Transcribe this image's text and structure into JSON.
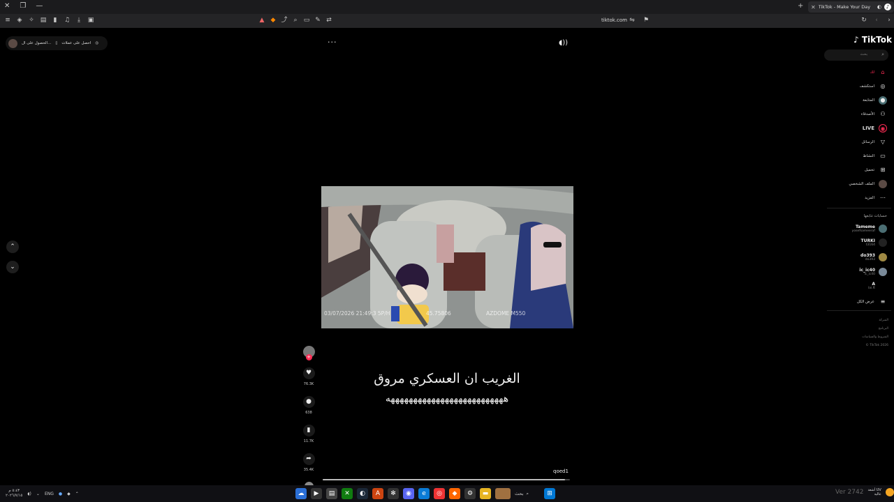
{
  "browser": {
    "tab_title": "TikTok - Make Your Day",
    "tab_icon": "tiktok-icon",
    "url": "tiktok.com",
    "tab_close": "✕",
    "new_tab": "+"
  },
  "player": {
    "more_label": "···",
    "volume_icon": "speaker-icon",
    "pill_get_coins": "احصل على عملات",
    "pill_get_app": "الحصول على ال...",
    "stamp_left": "03/07/2026 21:49:3  5P/H",
    "stamp_mid": "45.75806",
    "stamp_right": "AZDOME M550",
    "caption_line1": "الغريب ان العسكري مروق",
    "caption_line2": "ههههههههههههههههههههههههههه",
    "author": "qoed1",
    "progress_fraction": 0.98
  },
  "actions": {
    "likes": "76.3K",
    "comments": "638",
    "saves": "11.7K",
    "shares": "35.4K"
  },
  "sidebar": {
    "logo": "TikTok",
    "search_placeholder": "بحث",
    "nav": [
      {
        "label": "لك",
        "icon": "home-icon",
        "active": true
      },
      {
        "label": "استكشف",
        "icon": "compass-icon"
      },
      {
        "label": "المتابعة",
        "icon": "following-icon"
      },
      {
        "label": "الأصدقاء",
        "icon": "friends-icon"
      },
      {
        "label": "LIVE",
        "icon": "live-icon"
      },
      {
        "label": "الرسائل",
        "icon": "messages-icon"
      },
      {
        "label": "النشاط",
        "icon": "activity-icon"
      },
      {
        "label": "تحميل",
        "icon": "upload-icon"
      },
      {
        "label": "الملف الشخصي",
        "icon": "profile-icon"
      },
      {
        "label": "المزيد",
        "icon": "more-icon"
      }
    ],
    "following_title": "حسابات تتابعها",
    "accounts": [
      {
        "name": "Tameme",
        "handle": "yosefsameeraf",
        "color": "#4b6e73"
      },
      {
        "name": "TURKI",
        "handle": "t3164",
        "color": "#222222"
      },
      {
        "name": "do393",
        "handle": "do393",
        "color": "#a08a44"
      },
      {
        "name": "ic_ic40",
        "handle": "ic_ic40",
        "color": "#7a8a99"
      },
      {
        "name": "A",
        "handle": "lai.ft",
        "color": "#000000"
      }
    ],
    "show_more": "عرض الكل",
    "footer": [
      "الشركة",
      "البرنامج",
      "الشروط والسياسات",
      "© TikTok 2026"
    ]
  },
  "taskbar": {
    "time": "٥:٤٣ م",
    "date": "٢٠٢٦/٧/١٥",
    "lang": "ENG",
    "search_label": "بحث",
    "version": "Ver 2742",
    "weather": "أشعة UV",
    "weather2": "عالية"
  }
}
